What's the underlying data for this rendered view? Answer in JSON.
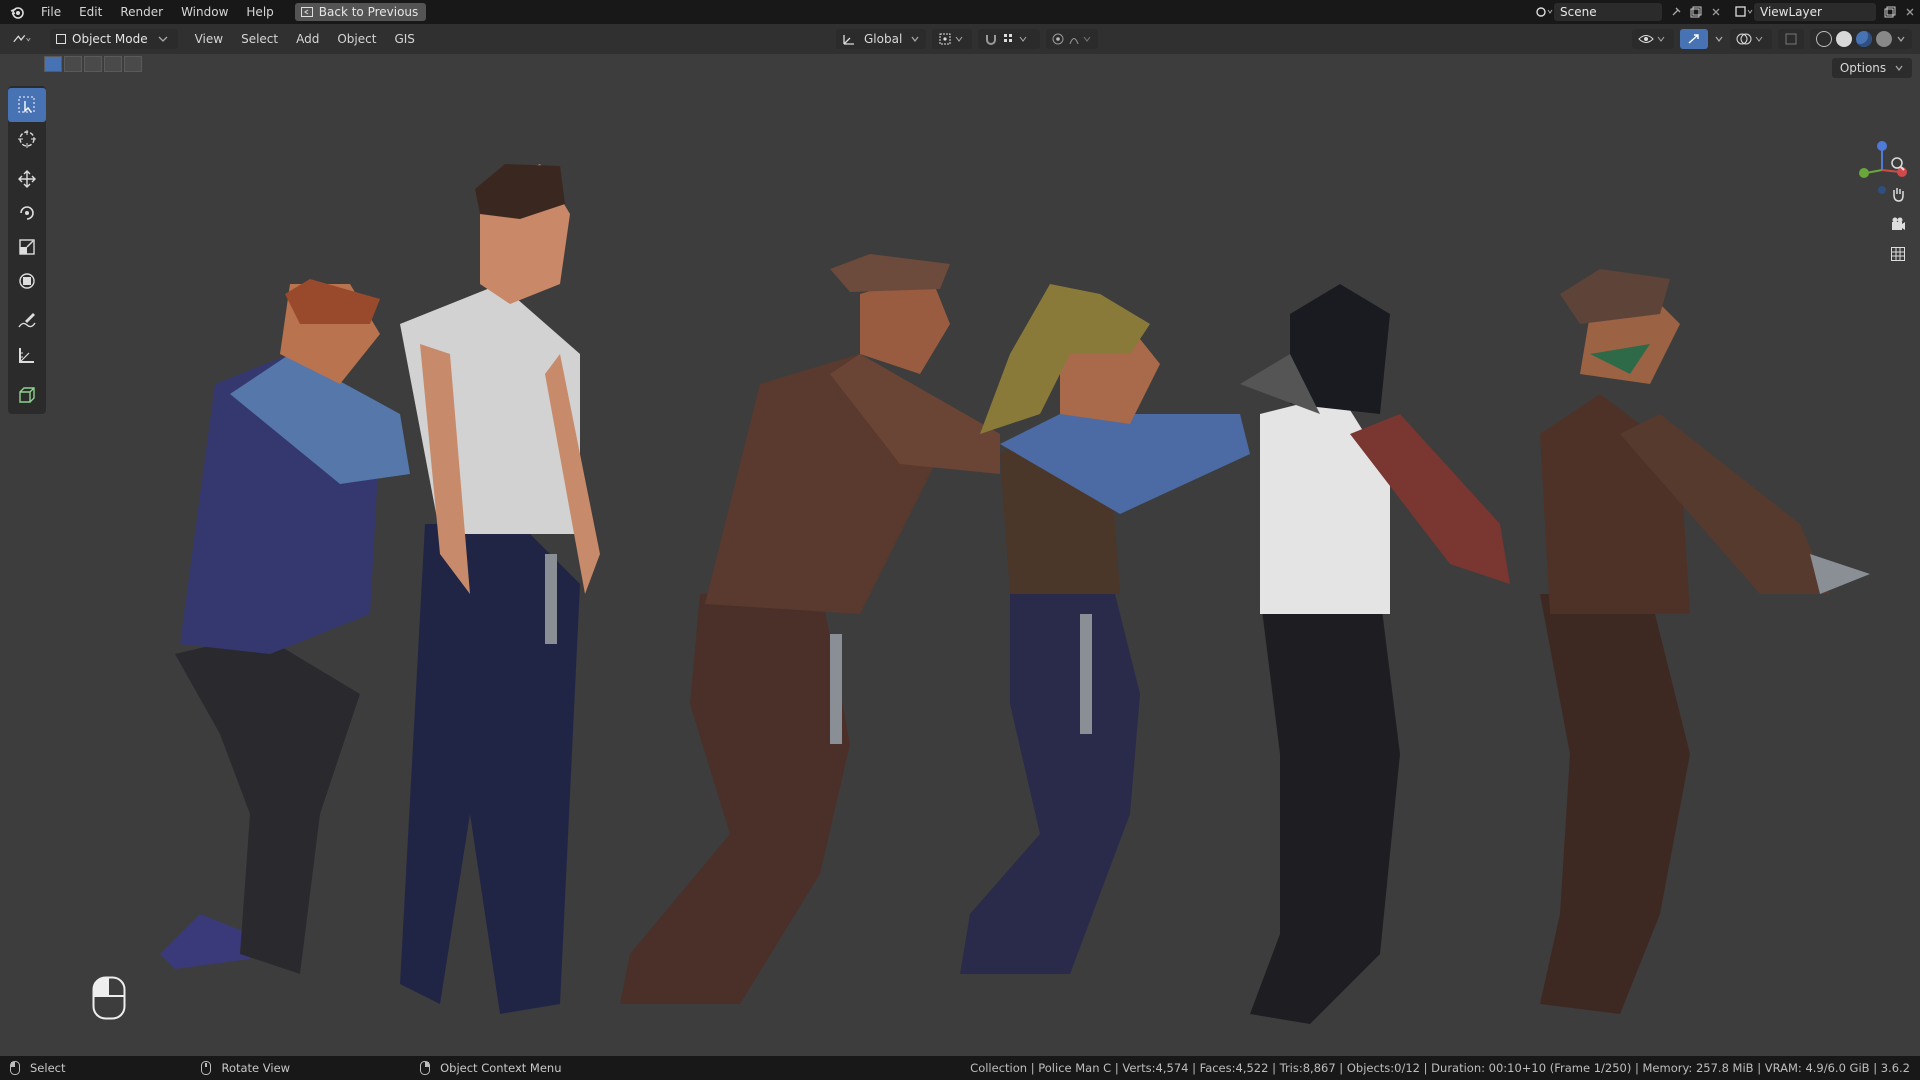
{
  "topbar": {
    "menus": [
      "File",
      "Edit",
      "Render",
      "Window",
      "Help"
    ],
    "back_button": "Back to Previous",
    "scene_name": "Scene",
    "view_layer": "ViewLayer"
  },
  "header": {
    "mode": "Object Mode",
    "menus": [
      "View",
      "Select",
      "Add",
      "Object",
      "GIS"
    ],
    "transform_orientation": "Global",
    "options": "Options"
  },
  "tools": [
    "select-box",
    "cursor",
    "move",
    "rotate",
    "scale",
    "transform",
    "annotate",
    "measure",
    "add-cube"
  ],
  "viewport": {
    "subject": "six low-poly police characters walking in a line",
    "figure_colors": [
      "#3a4a8a",
      "#d8d8d8",
      "#5a3a2e",
      "#4c6aa3",
      "#e4e4e4",
      "#4e3228"
    ]
  },
  "statusbar": {
    "hint_select": "Select",
    "hint_rotate": "Rotate View",
    "hint_context": "Object Context Menu",
    "stats": "Collection | Police Man C | Verts:4,574 | Faces:4,522 | Tris:8,867 | Objects:0/12 | Duration: 00:10+10 (Frame 1/250) | Memory: 257.8 MiB | VRAM: 4.9/6.0 GiB | 3.6.2"
  }
}
